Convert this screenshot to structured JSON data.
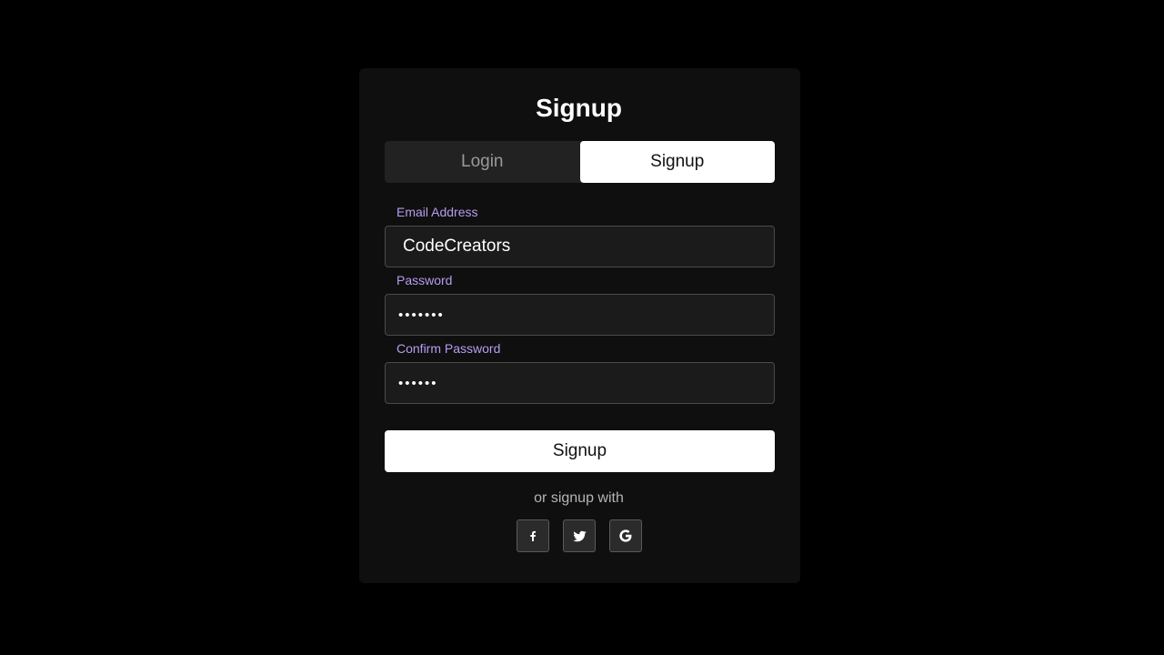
{
  "form": {
    "heading": "Signup",
    "tabs": [
      {
        "label": "Login",
        "active": false
      },
      {
        "label": "Signup",
        "active": true
      }
    ],
    "fields": {
      "email": {
        "label": "Email Address",
        "value": "CodeCreators"
      },
      "password": {
        "label": "Password",
        "value": "•••••••"
      },
      "confirm": {
        "label": "Confirm Password",
        "value": "••••••"
      }
    },
    "submit_label": "Signup",
    "alt_text": "or signup with",
    "social": [
      {
        "icon": "facebook-icon"
      },
      {
        "icon": "twitter-icon"
      },
      {
        "icon": "google-icon"
      }
    ]
  },
  "colors": {
    "background": "#000000",
    "card": "#0f0f0f",
    "label_accent": "#b79cf0",
    "active_tab": "#ffffff",
    "inactive_tab": "#222222"
  }
}
